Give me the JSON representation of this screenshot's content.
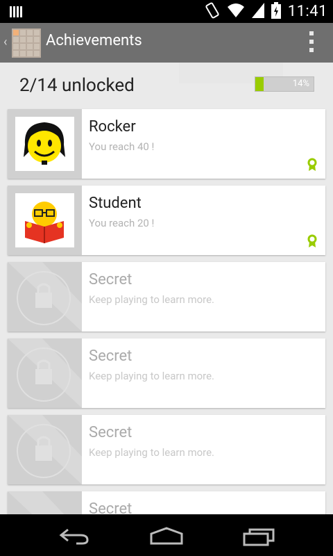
{
  "status_bar": {
    "time": "11:41"
  },
  "action_bar": {
    "title": "Achievements"
  },
  "summary": {
    "unlocked_text": "2/14 unlocked",
    "progress_percent": 14,
    "progress_label": "14%"
  },
  "achievements": [
    {
      "name": "Rocker",
      "description": "You reach 40 !",
      "locked": false
    },
    {
      "name": "Student",
      "description": "You reach 20 !",
      "locked": false
    },
    {
      "name": "Secret",
      "description": "Keep playing to learn more.",
      "locked": true
    },
    {
      "name": "Secret",
      "description": "Keep playing to learn more.",
      "locked": true
    },
    {
      "name": "Secret",
      "description": "Keep playing to learn more.",
      "locked": true
    },
    {
      "name": "Secret",
      "description": "",
      "locked": true
    }
  ],
  "colors": {
    "accent": "#99cc00",
    "actionbar": "#6f6f6f"
  }
}
